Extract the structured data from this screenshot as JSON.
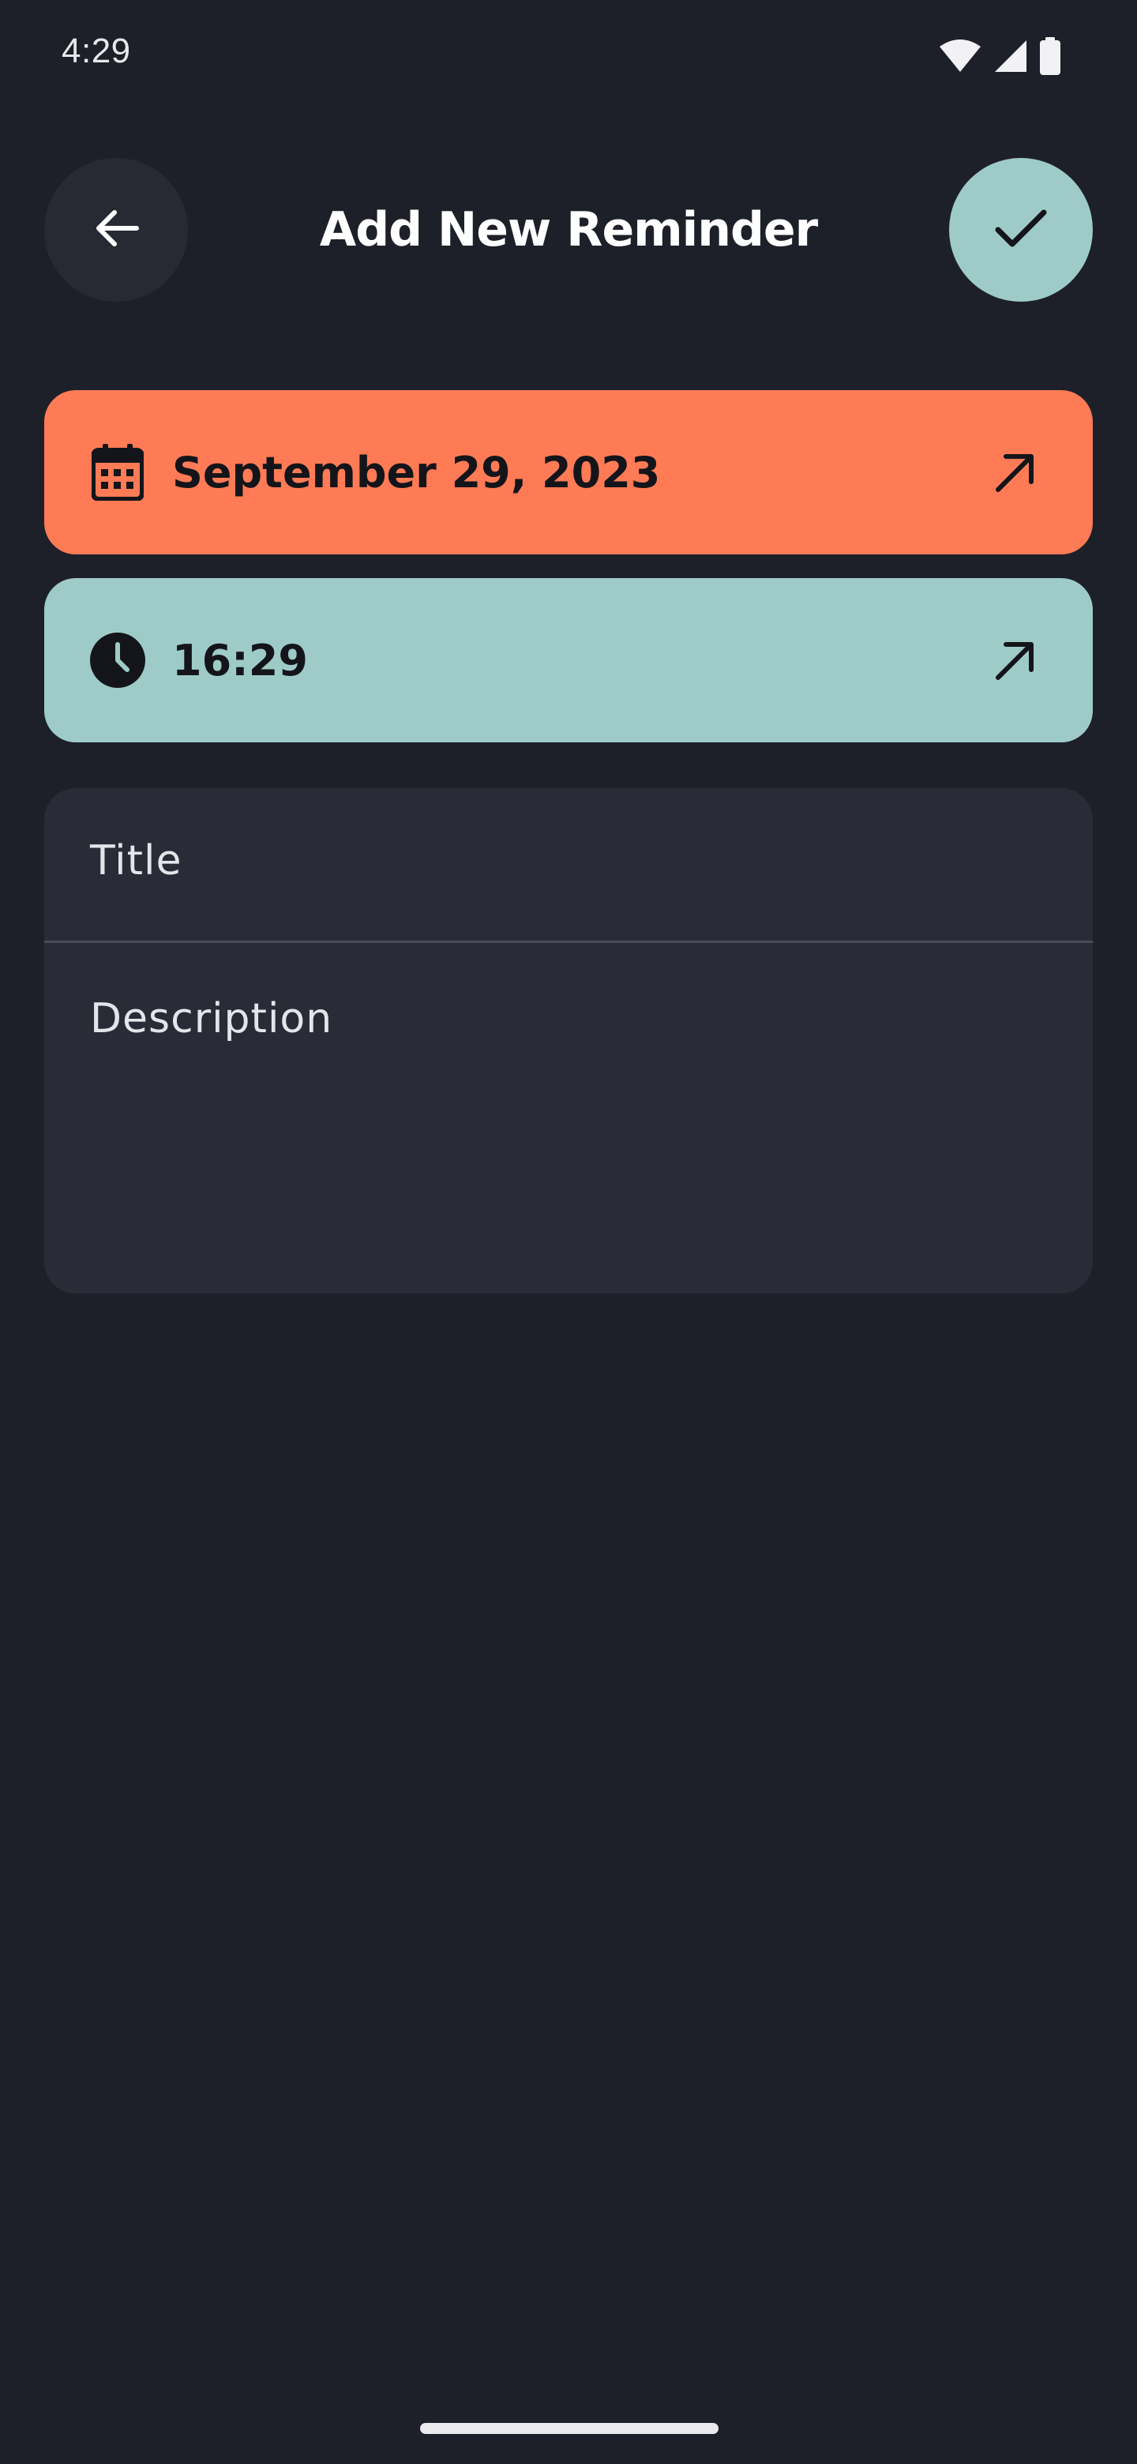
{
  "status_bar": {
    "time": "4:29",
    "icons": [
      "wifi-icon",
      "signal-icon",
      "battery-icon"
    ]
  },
  "header": {
    "title": "Add New Reminder",
    "back_icon": "arrow-back-icon",
    "confirm_icon": "check-icon"
  },
  "date_picker": {
    "value": "September 29, 2023",
    "icon": "calendar-icon",
    "arrow_icon": "arrow-up-right-icon",
    "color": "#ff7b56"
  },
  "time_picker": {
    "value": "16:29",
    "icon": "clock-icon",
    "arrow_icon": "arrow-up-right-icon",
    "color": "#9ecbc8"
  },
  "form": {
    "title_placeholder": "Title",
    "description_placeholder": "Description"
  },
  "colors": {
    "background": "#1d2029",
    "card": "#292c36",
    "accent_teal": "#9ecbc8",
    "accent_orange": "#ff7b56"
  }
}
